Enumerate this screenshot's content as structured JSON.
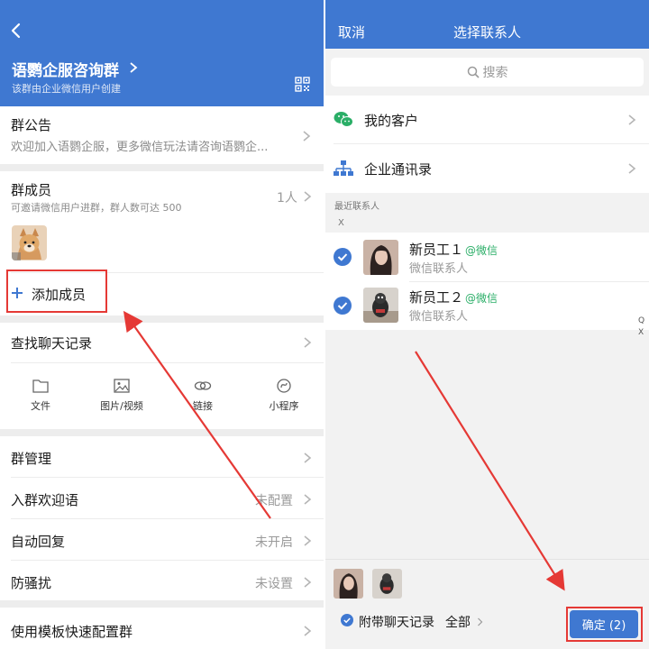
{
  "left": {
    "group_name": "语鹦企服咨询群",
    "group_subtitle": "该群由企业微信用户创建",
    "notice": {
      "title": "群公告",
      "content": "欢迎加入语鹦企服，更多微信玩法请咨询语鹦企..."
    },
    "members": {
      "title": "群成员",
      "count": "1人",
      "subtitle": "可邀请微信用户进群，群人数可达 500",
      "add_label": "添加成员"
    },
    "find_history": "查找聊天记录",
    "tools": [
      {
        "label": "文件",
        "icon": "folder-icon"
      },
      {
        "label": "图片/视频",
        "icon": "image-icon"
      },
      {
        "label": "链接",
        "icon": "link-icon"
      },
      {
        "label": "小程序",
        "icon": "mini-program-icon"
      }
    ],
    "settings": [
      {
        "label": "群管理",
        "value": ""
      },
      {
        "label": "入群欢迎语",
        "value": "未配置"
      },
      {
        "label": "自动回复",
        "value": "未开启"
      },
      {
        "label": "防骚扰",
        "value": "未设置"
      }
    ],
    "template_config": "使用模板快速配置群"
  },
  "right": {
    "cancel": "取消",
    "title": "选择联系人",
    "search_placeholder": "搜索",
    "my_customers": "我的客户",
    "org_directory": "企业通讯录",
    "recent_label": "最近联系人",
    "index_letter": "X",
    "contacts": [
      {
        "name": "新员工１",
        "tag": "@微信",
        "sub": "微信联系人"
      },
      {
        "name": "新员工２",
        "tag": "@微信",
        "sub": "微信联系人"
      }
    ],
    "side_index": [
      "Q",
      "X"
    ],
    "bottom": {
      "with_history": "附带聊天记录",
      "scope": "全部",
      "confirm": "确定 (2)"
    }
  },
  "colors": {
    "brand_blue": "#3f78d1",
    "annotation_red": "#e53935",
    "wechat_green": "#2aae67"
  }
}
